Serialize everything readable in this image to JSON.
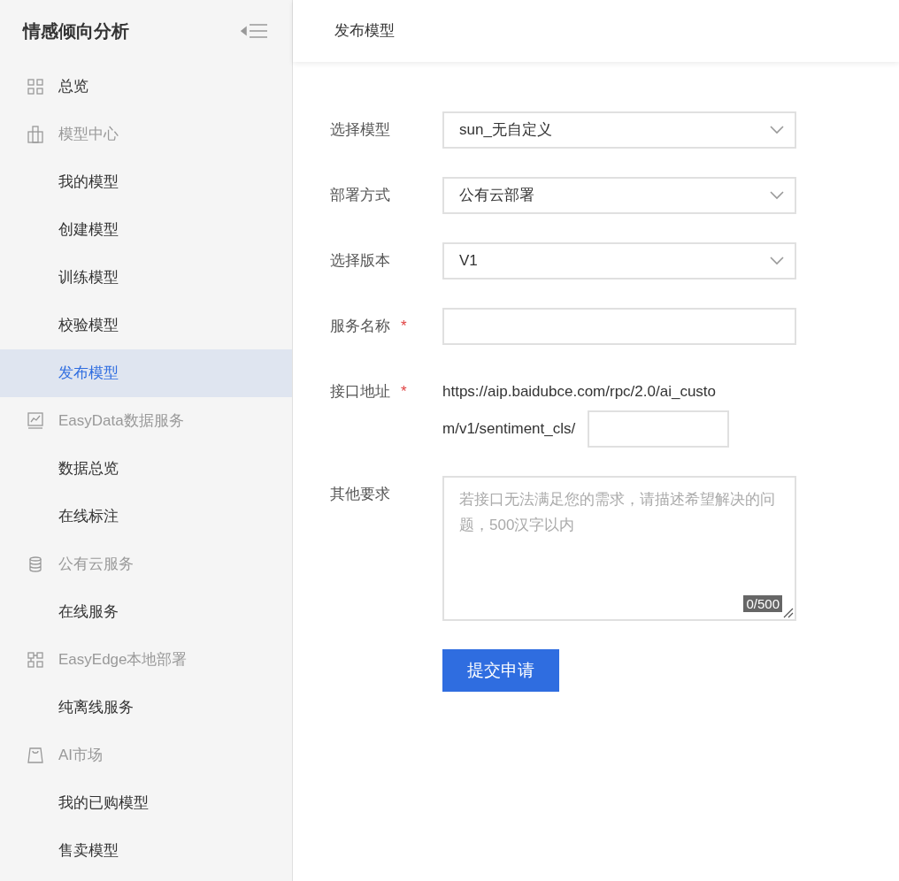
{
  "sidebar": {
    "title": "情感倾向分析",
    "items": [
      {
        "label": "总览",
        "selected": false
      },
      {
        "label": "模型中心",
        "selected": false,
        "children": [
          {
            "label": "我的模型",
            "selected": false
          },
          {
            "label": "创建模型",
            "selected": false
          },
          {
            "label": "训练模型",
            "selected": false
          },
          {
            "label": "校验模型",
            "selected": false
          },
          {
            "label": "发布模型",
            "selected": true
          }
        ]
      },
      {
        "label": "EasyData数据服务",
        "selected": false,
        "children": [
          {
            "label": "数据总览",
            "selected": false
          },
          {
            "label": "在线标注",
            "selected": false
          }
        ]
      },
      {
        "label": "公有云服务",
        "selected": false,
        "children": [
          {
            "label": "在线服务",
            "selected": false
          }
        ]
      },
      {
        "label": "EasyEdge本地部署",
        "selected": false,
        "children": [
          {
            "label": "纯离线服务",
            "selected": false
          }
        ]
      },
      {
        "label": "AI市场",
        "selected": false,
        "children": [
          {
            "label": "我的已购模型",
            "selected": false
          },
          {
            "label": "售卖模型",
            "selected": false
          }
        ]
      }
    ]
  },
  "header": {
    "title": "发布模型"
  },
  "form": {
    "fields": [
      {
        "kind": "select",
        "label": "选择模型",
        "value": "sun_无自定义"
      },
      {
        "kind": "select",
        "label": "部署方式",
        "value": "公有云部署"
      },
      {
        "kind": "select",
        "label": "选择版本",
        "value": "V1"
      },
      {
        "kind": "input",
        "label": "服务名称",
        "required_mark": "*"
      },
      {
        "kind": "url",
        "label": "接口地址",
        "required_mark": "*",
        "prefix_lines": [
          "https://aip.baidubce.com/rpc/2.0/ai_custo",
          "m/v1/sentiment_cls/"
        ]
      },
      {
        "kind": "textarea",
        "label": "其他要求",
        "placeholder": "若接口无法满足您的需求，请描述希望解决的问题，500汉字以内",
        "counter": "0/500"
      }
    ],
    "submit": "提交申请"
  }
}
